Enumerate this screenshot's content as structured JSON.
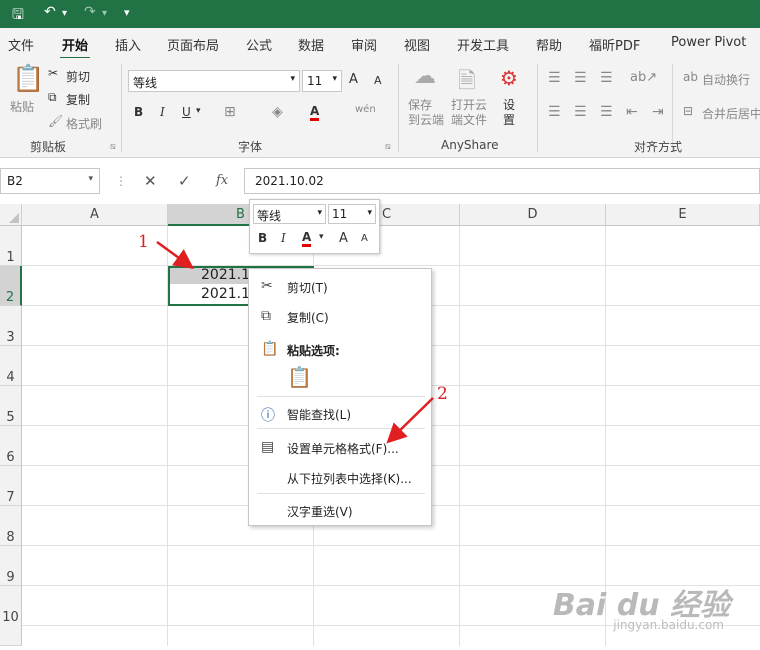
{
  "qat": {
    "save_icon": "save-icon",
    "undo_icon": "undo-icon",
    "redo_icon": "redo-icon",
    "more": "▾"
  },
  "tabs": [
    "文件",
    "开始",
    "插入",
    "页面布局",
    "公式",
    "数据",
    "审阅",
    "视图",
    "开发工具",
    "帮助",
    "福昕PDF",
    "Power Pivot"
  ],
  "active_tab": "开始",
  "ribbon": {
    "clipboard": {
      "paste": "粘贴",
      "cut": "剪切",
      "copy": "复制",
      "format_painter": "格式刷",
      "label": "剪贴板"
    },
    "font": {
      "name": "等线",
      "size": "11",
      "label": "字体",
      "bold": "B",
      "italic": "I",
      "underline": "U",
      "grow": "A",
      "shrink": "A",
      "wen": "wén"
    },
    "anyshare": {
      "save": "保存\n到云端",
      "open": "打开云\n端文件",
      "settings": "设\n置",
      "label": "AnyShare"
    },
    "align": {
      "wrap": "自动换行",
      "merge": "合并后居中",
      "label": "对齐方式"
    }
  },
  "formula_bar": {
    "name_box": "B2",
    "fx": "fx",
    "value": "2021.10.02",
    "cancel": "✕",
    "enter": "✓"
  },
  "columns": [
    "A",
    "B",
    "C",
    "D",
    "E"
  ],
  "rows": [
    "1",
    "2",
    "3",
    "4",
    "5",
    "6",
    "7",
    "8",
    "9",
    "10"
  ],
  "cells": {
    "B1": "2021.1",
    "B2": "2021.1"
  },
  "mini_toolbar": {
    "font": "等线",
    "size": "11",
    "bold": "B",
    "italic": "I",
    "font_color": "A",
    "grow": "A",
    "shrink": "A"
  },
  "context_menu": [
    {
      "label": "剪切(T)",
      "icon": "scissors-icon"
    },
    {
      "label": "复制(C)",
      "icon": "copy-icon"
    },
    {
      "label": "粘贴选项:",
      "icon": "paste-icon"
    },
    {
      "label": "智能查找(L)",
      "icon": "info-search-icon"
    },
    {
      "label": "设置单元格格式(F)...",
      "icon": "format-cells-icon"
    },
    {
      "label": "从下拉列表中选择(K)...",
      "icon": ""
    },
    {
      "label": "汉字重选(V)",
      "icon": ""
    }
  ],
  "annotations": [
    "1",
    "2"
  ],
  "watermark": {
    "text": "Bai du 经验",
    "url": "jingyan.baidu.com"
  },
  "colors": {
    "accent": "#217346",
    "arrow": "#e02020",
    "selection": "#217346"
  }
}
